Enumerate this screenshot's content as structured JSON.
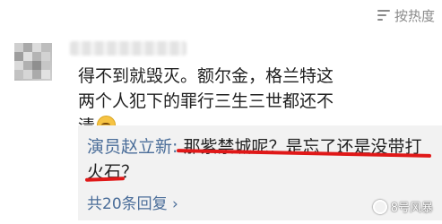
{
  "sort": {
    "label": "按热度",
    "icon": "sort-lines-icon"
  },
  "comment": {
    "avatar_icon": "blurred-avatar",
    "text": "得不到就毁灭。额尔金，格兰特这两个人犯下的罪行三生三世都还不清",
    "emoji_icon": "pensive-face-emoji"
  },
  "reply": {
    "author": "演员赵立新:",
    "text": " 那紫禁城呢？是忘了还是没带打火石？",
    "count_label": "共20条回复",
    "count_arrow": "›"
  },
  "watermark": {
    "text": "8号风暴"
  },
  "colors": {
    "link": "#4a6d99",
    "underline": "#e01818",
    "reply_bg": "#f2f2f2"
  }
}
